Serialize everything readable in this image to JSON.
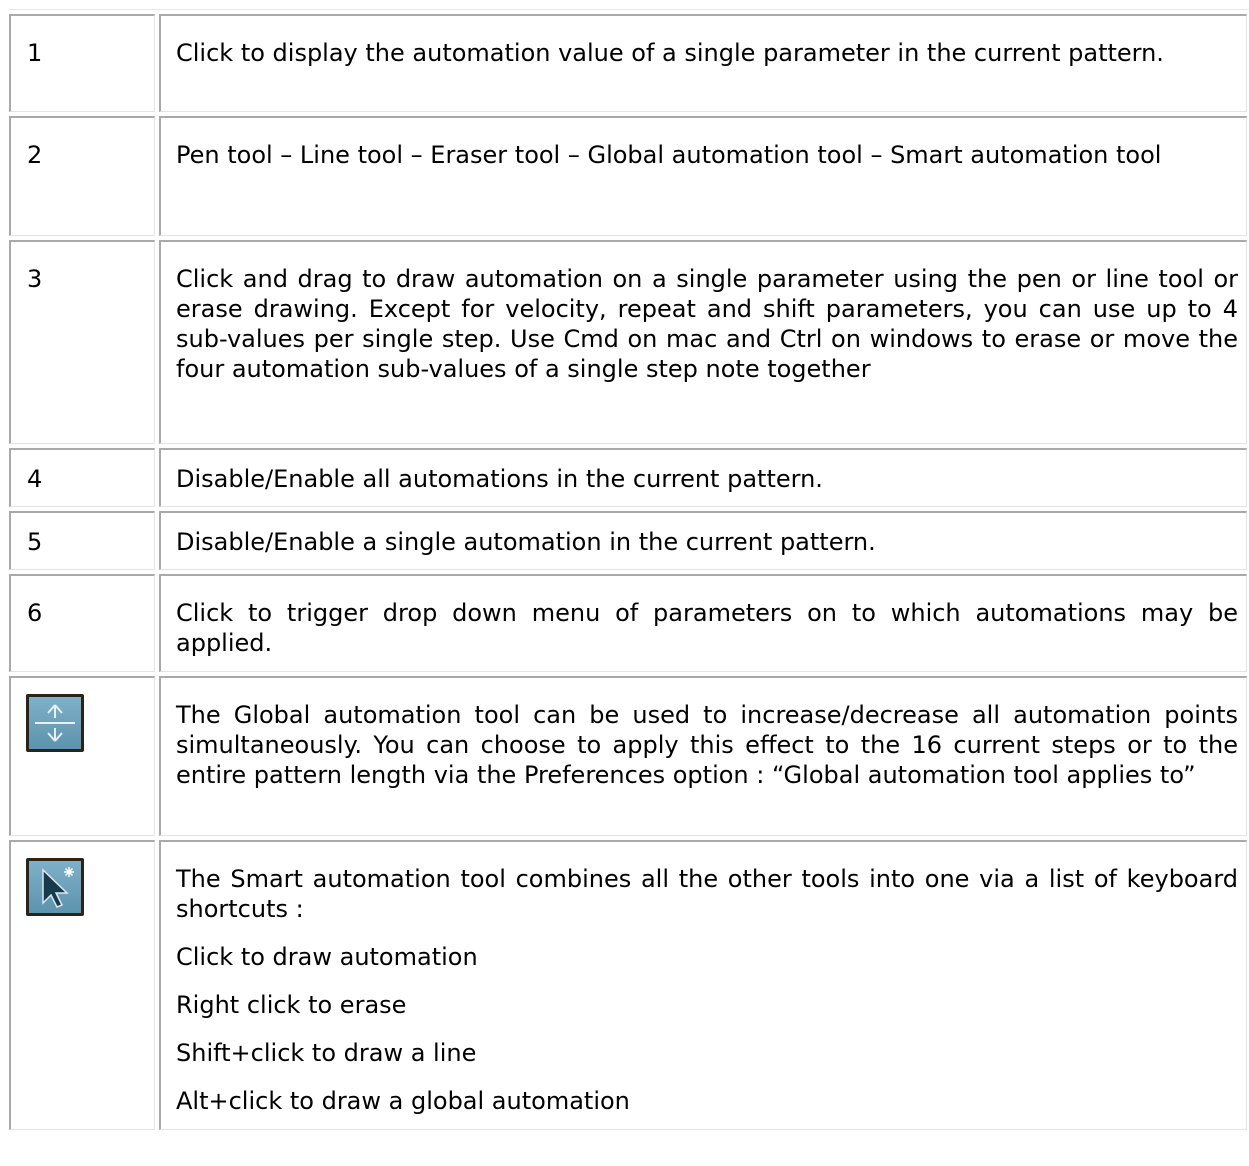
{
  "rows": [
    {
      "label": "1",
      "lines": [
        "Click to display the automation value of a single parameter in the current pattern."
      ]
    },
    {
      "label": "2",
      "lines": [
        "Pen tool – Line tool – Eraser tool – Global automation tool – Smart automation tool"
      ]
    },
    {
      "label": "3",
      "lines": [
        "Click and drag to draw automation on a single parameter using the pen or line tool or erase drawing. Except for velocity, repeat and shift parameters, you can use up to 4 sub-values per single step. Use Cmd on mac and Ctrl on windows to erase or move the four automation sub-values of a single step note together"
      ]
    },
    {
      "label": "4",
      "lines": [
        "Disable/Enable all automations in the current pattern."
      ]
    },
    {
      "label": "5",
      "lines": [
        "Disable/Enable a single automation in the current pattern."
      ]
    },
    {
      "label": "6",
      "lines": [
        "Click to trigger drop down menu of parameters on to which automations may be applied."
      ]
    },
    {
      "icon": "global-automation-tool-icon",
      "lines": [
        "The Global automation tool can be used to increase/decrease all automation points simultaneously. You can choose to apply this effect to the 16 current steps or to the entire pattern length via the Preferences option : “Global automation tool applies to”"
      ]
    },
    {
      "icon": "smart-automation-tool-icon",
      "lines": [
        "The Smart automation tool combines all the other tools into one via a list of keyboard shortcuts :",
        "Click to draw automation",
        "Right click to erase",
        "Shift+click to draw a line",
        "Alt+click to draw a global automation"
      ]
    }
  ]
}
